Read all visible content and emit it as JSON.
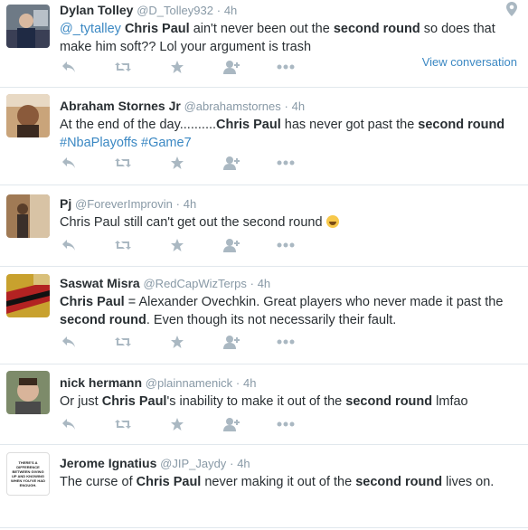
{
  "tweets": [
    {
      "fullname": "Dylan Tolley",
      "username": "@D_Tolley932",
      "time": "4h",
      "segments": [
        {
          "text": "@_tytalley",
          "style": "mention"
        },
        {
          "text": " ",
          "style": "plain"
        },
        {
          "text": "Chris Paul",
          "style": "bold"
        },
        {
          "text": " ain't never been out the ",
          "style": "plain"
        },
        {
          "text": "second round",
          "style": "bold"
        },
        {
          "text": " so does that make him soft?? Lol your argument is trash",
          "style": "plain"
        }
      ],
      "view_conversation": "View conversation",
      "has_geo": true
    },
    {
      "fullname": "Abraham Stornes Jr",
      "username": "@abrahamstornes",
      "time": "4h",
      "segments": [
        {
          "text": "At the end of the day..........",
          "style": "plain"
        },
        {
          "text": "Chris Paul",
          "style": "bold"
        },
        {
          "text": " has never got past the ",
          "style": "plain"
        },
        {
          "text": "second round",
          "style": "bold"
        },
        {
          "text": " ",
          "style": "plain"
        },
        {
          "text": "#NbaPlayoffs",
          "style": "hashtag"
        },
        {
          "text": " ",
          "style": "plain"
        },
        {
          "text": "#Game7",
          "style": "hashtag"
        }
      ]
    },
    {
      "fullname": "Pj",
      "username": "@ForeverImprovin",
      "time": "4h",
      "segments": [
        {
          "text": "Chris Paul still can't get out the second round ",
          "style": "plain"
        },
        {
          "text": "",
          "style": "emoji"
        }
      ]
    },
    {
      "fullname": "Saswat Misra",
      "username": "@RedCapWizTerps",
      "time": "4h",
      "segments": [
        {
          "text": "Chris Paul",
          "style": "bold"
        },
        {
          "text": " = Alexander Ovechkin. Great players who never made it past the ",
          "style": "plain"
        },
        {
          "text": "second round",
          "style": "bold"
        },
        {
          "text": ". Even though its not necessarily their fault.",
          "style": "plain"
        }
      ]
    },
    {
      "fullname": "nick hermann",
      "username": "@plainnamenick",
      "time": "4h",
      "segments": [
        {
          "text": "Or just ",
          "style": "plain"
        },
        {
          "text": "Chris Paul",
          "style": "bold"
        },
        {
          "text": "'s inability to make it out of the ",
          "style": "plain"
        },
        {
          "text": "second round",
          "style": "bold"
        },
        {
          "text": " lmfao",
          "style": "plain"
        }
      ]
    },
    {
      "fullname": "Jerome Ignatius",
      "username": "@JIP_Jaydy",
      "time": "4h",
      "segments": [
        {
          "text": "The curse of ",
          "style": "plain"
        },
        {
          "text": "Chris Paul",
          "style": "bold"
        },
        {
          "text": " never making it out of the ",
          "style": "plain"
        },
        {
          "text": "second round",
          "style": "bold"
        },
        {
          "text": " lives on.",
          "style": "plain"
        }
      ],
      "avatar_text": "THERE'S A DIFFERENCE BETWEEN GIVING UP AND KNOWING WHEN YOU'VE HAD ENOUGH."
    }
  ],
  "actions": [
    "reply-icon",
    "retweet-icon",
    "favorite-icon",
    "follow-icon",
    "more-icon"
  ],
  "colors": {
    "link": "#3b88c3",
    "meta": "#8899a6",
    "icon": "#aab8c2",
    "text": "#292f33"
  }
}
